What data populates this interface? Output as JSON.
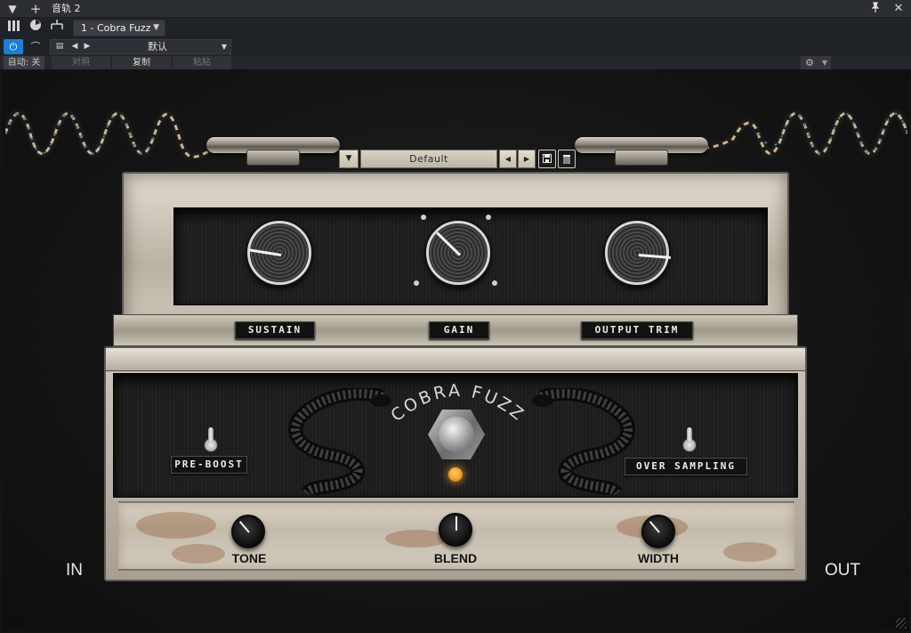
{
  "window": {
    "title": "音轨 2",
    "instrument": "1 - Cobra Fuzz"
  },
  "host_toolbar": {
    "preset": "默认",
    "auto_label": "自动: 关",
    "compare_label": "对照",
    "copy_label": "复制",
    "paste_label": "粘贴"
  },
  "plugin": {
    "preset_name": "Default",
    "logo_text": "COBRA FUZZ",
    "top_knobs": [
      {
        "label": "SUSTAIN",
        "value": 0.2
      },
      {
        "label": "GAIN",
        "value": 0.33
      },
      {
        "label": "OUTPUT TRIM",
        "value": 0.85
      }
    ],
    "switches": [
      {
        "label": "PRE-BOOST"
      },
      {
        "label": "OVER SAMPLING"
      }
    ],
    "bottom_knobs": [
      {
        "label": "TONE",
        "value": 0.35
      },
      {
        "label": "BLEND",
        "value": 0.5
      },
      {
        "label": "WIDTH",
        "value": 0.35
      }
    ],
    "input_label": "IN",
    "output_label": "OUT",
    "led_color": "#f59a1e"
  },
  "icons": [
    "menu-caret-icon",
    "plus-icon",
    "pin-icon",
    "close-icon",
    "mixer-icon",
    "gauge-icon",
    "routing-icon",
    "power-icon",
    "compare-icon",
    "preset-list-icon",
    "prev-arrow-icon",
    "next-arrow-icon",
    "gear-icon",
    "save-icon",
    "trash-icon"
  ]
}
